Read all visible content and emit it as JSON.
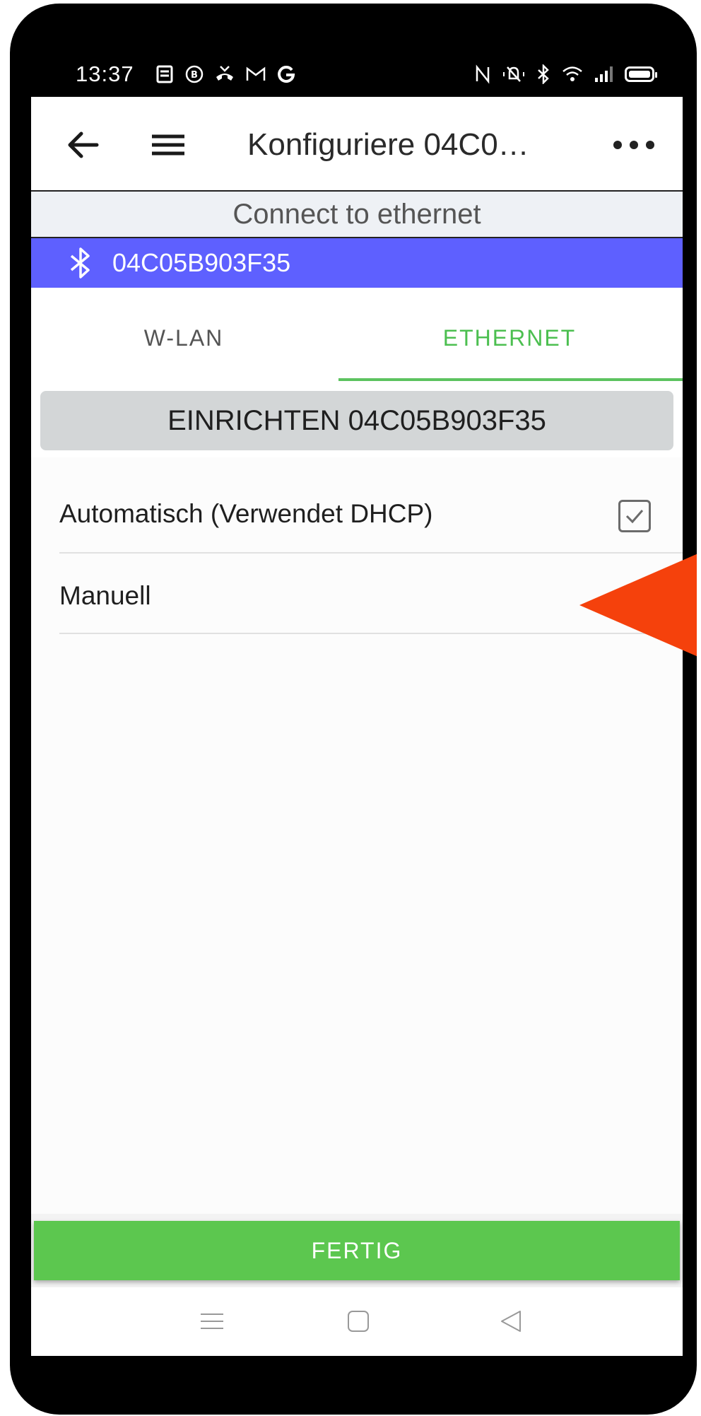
{
  "status_bar": {
    "time": "13:37",
    "left_icons": [
      "notes-icon",
      "b-circle-icon",
      "missed-call-icon",
      "gmail-icon",
      "google-icon"
    ],
    "right_icons": [
      "nfc-icon",
      "vibrate-off-icon",
      "bluetooth-icon",
      "wifi-icon",
      "signal-icon",
      "battery-icon"
    ]
  },
  "app_bar": {
    "title": "Konfiguriere 04C0…"
  },
  "connect_banner": "Connect to ethernet",
  "device_bar": {
    "device_id": "04C05B903F35",
    "color": "#5e60ff"
  },
  "tabs": [
    {
      "label": "W-LAN",
      "selected": false
    },
    {
      "label": "ETHERNET",
      "selected": true
    }
  ],
  "setup_header": "EINRICHTEN 04C05B903F35",
  "options": [
    {
      "label": "Automatisch (Verwendet DHCP)",
      "checked": true
    },
    {
      "label": "Manuell",
      "checked": false
    }
  ],
  "done_button": "FERTIG",
  "colors": {
    "accent_green": "#5cc74f",
    "pointer_orange": "#f5410c",
    "device_bar_blue": "#5e60ff"
  }
}
